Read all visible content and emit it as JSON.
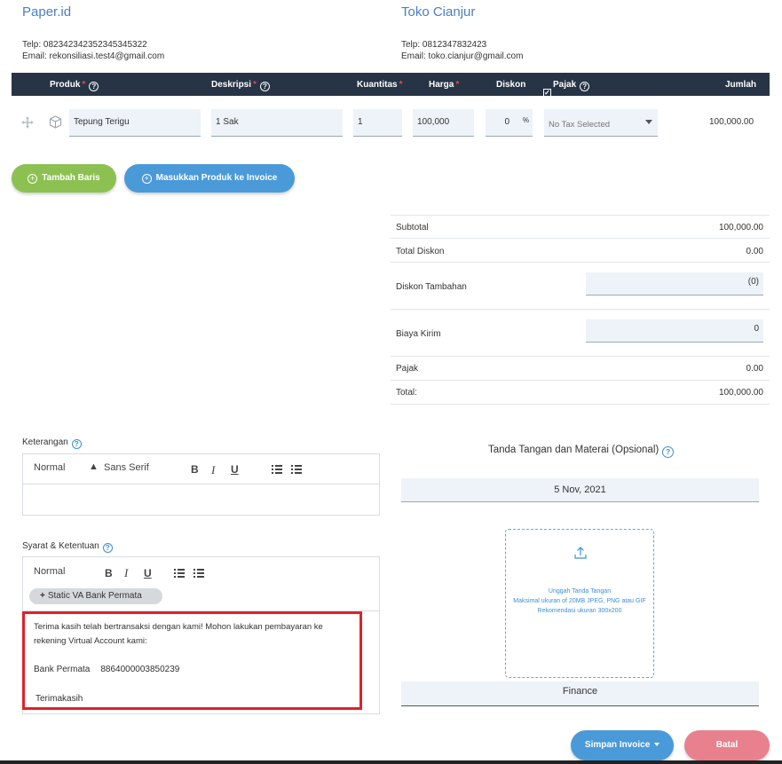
{
  "seller": {
    "name": "Paper.id",
    "phone": "Telp: 082342342352345345322",
    "email": "Email: rekonsiliasi.test4@gmail.com"
  },
  "buyer": {
    "name": "Toko Cianjur",
    "phone": "Telp: 0812347832423",
    "email": "Email: toko.cianjur@gmail.com"
  },
  "table": {
    "headers": {
      "produk": "Produk",
      "deskripsi": "Deskripsi",
      "kuantitas": "Kuantitas",
      "harga": "Harga",
      "diskon": "Diskon",
      "pajak": "Pajak",
      "jumlah": "Jumlah"
    },
    "required_mark": "*",
    "row": {
      "produk": "Tepung Terigu",
      "deskripsi": "1 Sak",
      "kuantitas": "1",
      "harga": "100,000",
      "diskon": "0",
      "diskon_unit": "%",
      "pajak": "No Tax Selected",
      "jumlah": "100,000.00"
    }
  },
  "buttons": {
    "tambah_baris": "Tambah Baris",
    "masukkan_produk": "Masukkan Produk ke Invoice",
    "simpan": "Simpan Invoice",
    "batal": "Batal"
  },
  "summary": {
    "subtotal_label": "Subtotal",
    "subtotal_value": "100,000.00",
    "total_diskon_label": "Total Diskon",
    "total_diskon_value": "0.00",
    "diskon_tambahan_label": "Diskon Tambahan",
    "diskon_tambahan_value": "(0)",
    "biaya_kirim_label": "Biaya Kirim",
    "biaya_kirim_value": "0",
    "pajak_label": "Pajak",
    "pajak_value": "0.00",
    "total_label": "Total:",
    "total_value": "100,000.00"
  },
  "keterangan": {
    "label": "Keterangan",
    "format": "Normal",
    "font": "Sans Serif"
  },
  "syarat": {
    "label": "Syarat & Ketentuan",
    "format": "Normal",
    "chip": "Static VA Bank Permata",
    "line1": "Terima kasih telah bertransaksi dengan kami! Mohon lakukan pembayaran ke",
    "line2": "rekening Virtual Account kami:",
    "bank_label": "Bank Permata",
    "bank_number": "8864000003850239",
    "closing": "Terimakasih"
  },
  "signature": {
    "title": "Tanda Tangan dan Materai (Opsional)",
    "date": "5 Nov, 2021",
    "upload_title": "Unggah Tanda Tangan",
    "upload_max": "Maksimal ukuran of 20MB JPEG, PNG atau GIF",
    "upload_rec": "Rekomendasi ukuran 300x200",
    "name": "Finance"
  },
  "colors": {
    "header_bg": "#263445",
    "green": "#8cc152",
    "blue": "#4a9ad9",
    "red": "#e8808e",
    "link": "#4a7fc1"
  },
  "icons": [
    "move-icon",
    "box-icon",
    "help-icon",
    "checkbox-icon",
    "caret-down-icon",
    "plus-circle-icon",
    "upload-icon",
    "bold-icon",
    "italic-icon",
    "underline-icon",
    "ordered-list-icon",
    "bullet-list-icon"
  ]
}
